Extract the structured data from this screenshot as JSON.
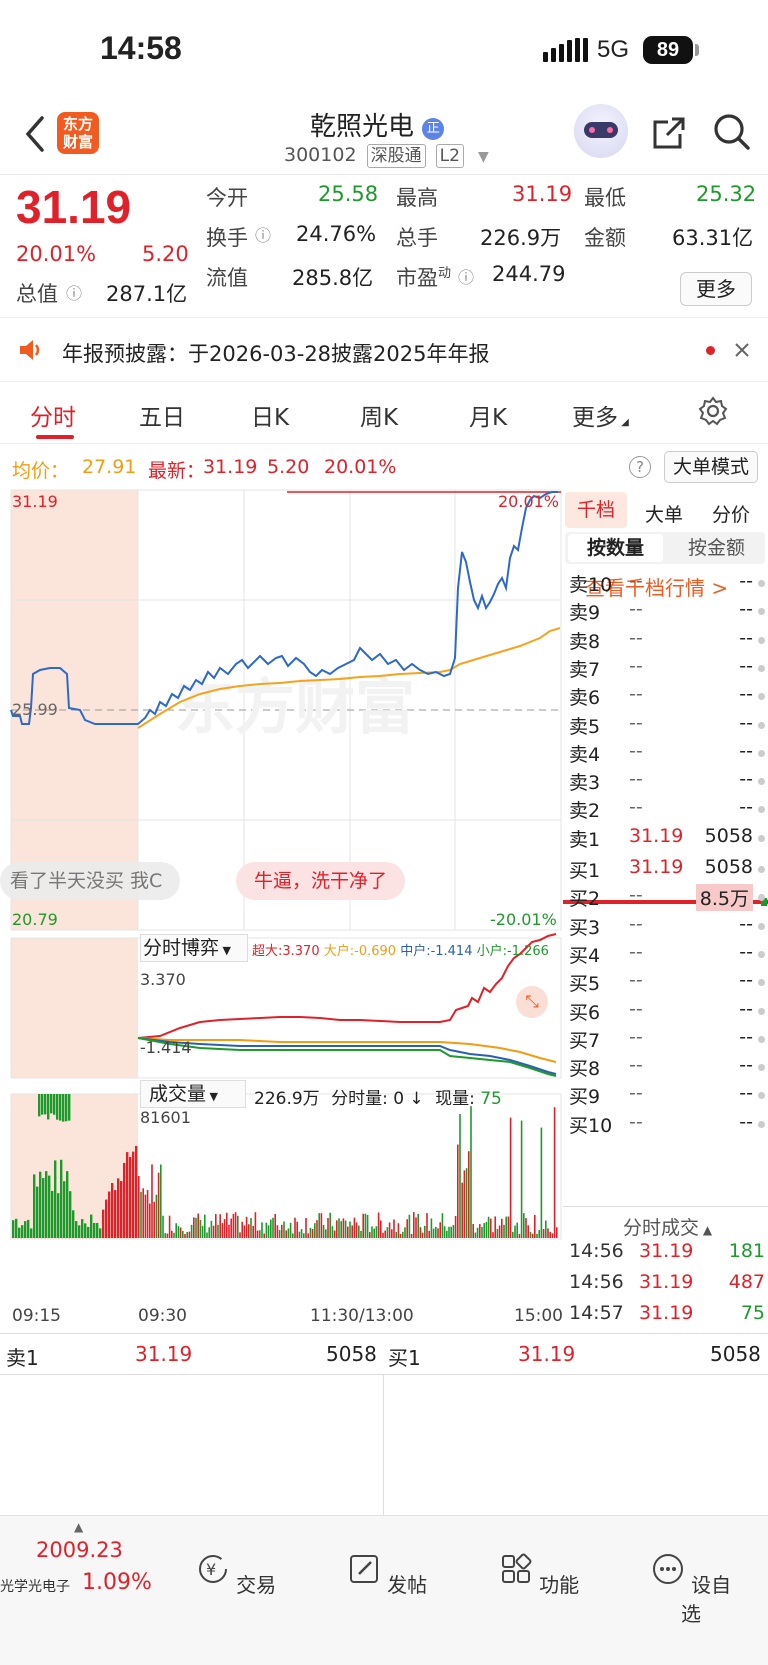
{
  "status_bar": {
    "time": "14:58",
    "network": "5G",
    "battery": "89"
  },
  "header": {
    "logo_text": "东方财富",
    "stock_name": "乾照光电",
    "stock_code": "300102",
    "tags": [
      "深股通",
      "L2"
    ]
  },
  "quote": {
    "price": "31.19",
    "change_pct": "20.01%",
    "change": "5.20",
    "open_label": "今开",
    "open": "25.58",
    "high_label": "最高",
    "high": "31.19",
    "low_label": "最低",
    "low": "25.32",
    "turnover_label": "换手",
    "turnover": "24.76%",
    "volume_label": "总手",
    "volume": "226.9万",
    "amount_label": "金额",
    "amount": "63.31亿",
    "mcap_label": "总值",
    "mcap": "287.1亿",
    "float_label": "流值",
    "float": "285.8亿",
    "pe_label": "市盈",
    "pe_sup": "动",
    "pe": "244.79",
    "more": "更多"
  },
  "notice": {
    "text": "年报预披露：于2026-03-28披露2025年年报"
  },
  "tabs": [
    "分时",
    "五日",
    "日K",
    "周K",
    "月K",
    "更多"
  ],
  "infobar": {
    "avg_label": "均价：",
    "avg": "27.91",
    "latest_label": "最新：",
    "latest": "31.19",
    "latest_change": "5.20",
    "latest_pct": "20.01%",
    "bigorder_btn": "大单模式"
  },
  "main_chart": {
    "top_price": "31.19",
    "top_pct": "20.01%",
    "mid_price": "25.99",
    "bottom_price": "20.79",
    "bottom_pct": "-20.01%",
    "watermark": "东方财富",
    "bubble1": "看了半天没买 我C",
    "bubble2": "牛逼，洗干净了",
    "x_labels": [
      "09:15",
      "09:30",
      "11:30/13:00",
      "15:00"
    ]
  },
  "flow_chart": {
    "selector": "分时博弈",
    "legend": [
      {
        "label": "超大:3.370",
        "color": "#e0212a"
      },
      {
        "label": "大户:-0.690",
        "color": "#f39c12"
      },
      {
        "label": "中户:-1.414",
        "color": "#2d5fb1"
      },
      {
        "label": "小户:-1.266",
        "color": "#1d9a2b"
      }
    ],
    "max": "3.370",
    "min": "-1.414"
  },
  "volume_chart": {
    "selector": "成交量",
    "total": "226.9万",
    "minute_label": "分时量: 0 ↓",
    "current_label": "现量:",
    "current": "75",
    "max": "81601"
  },
  "orderbook": {
    "tabs": [
      "千档",
      "大单",
      "分价"
    ],
    "subtabs": [
      "按数量",
      "按金额"
    ],
    "link": "查看千档行情 >",
    "asks": [
      {
        "label": "卖10",
        "price": "--",
        "qty": "--"
      },
      {
        "label": "卖9",
        "price": "--",
        "qty": "--"
      },
      {
        "label": "卖8",
        "price": "--",
        "qty": "--"
      },
      {
        "label": "卖7",
        "price": "--",
        "qty": "--"
      },
      {
        "label": "卖6",
        "price": "--",
        "qty": "--"
      },
      {
        "label": "卖5",
        "price": "--",
        "qty": "--"
      },
      {
        "label": "卖4",
        "price": "--",
        "qty": "--"
      },
      {
        "label": "卖3",
        "price": "--",
        "qty": "--"
      },
      {
        "label": "卖2",
        "price": "--",
        "qty": "--"
      },
      {
        "label": "卖1",
        "price": "31.19",
        "qty": "5058"
      }
    ],
    "bids": [
      {
        "label": "买1",
        "price": "31.19",
        "qty": "5058"
      },
      {
        "label": "买2",
        "price": "--",
        "qty": "8.5万"
      },
      {
        "label": "买3",
        "price": "--",
        "qty": "--"
      },
      {
        "label": "买4",
        "price": "--",
        "qty": "--"
      },
      {
        "label": "买5",
        "price": "--",
        "qty": "--"
      },
      {
        "label": "买6",
        "price": "--",
        "qty": "--"
      },
      {
        "label": "买7",
        "price": "--",
        "qty": "--"
      },
      {
        "label": "买8",
        "price": "--",
        "qty": "--"
      },
      {
        "label": "买9",
        "price": "--",
        "qty": "--"
      },
      {
        "label": "买10",
        "price": "--",
        "qty": "--"
      }
    ],
    "trades_title": "分时成交",
    "trades": [
      {
        "time": "14:56",
        "price": "31.19",
        "qty": "181"
      },
      {
        "time": "14:56",
        "price": "31.19",
        "qty": "487"
      },
      {
        "time": "14:57",
        "price": "31.19",
        "qty": "75"
      }
    ]
  },
  "bottom_quote": {
    "ask_label": "卖1",
    "ask_price": "31.19",
    "ask_qty": "5058",
    "bid_label": "买1",
    "bid_price": "31.19",
    "bid_qty": "5058"
  },
  "tabbar": {
    "index_value": "2009.23",
    "index_name": "光学光电子",
    "index_pct": "1.09%",
    "items": [
      "交易",
      "发帖",
      "功能",
      "设自选"
    ]
  }
}
